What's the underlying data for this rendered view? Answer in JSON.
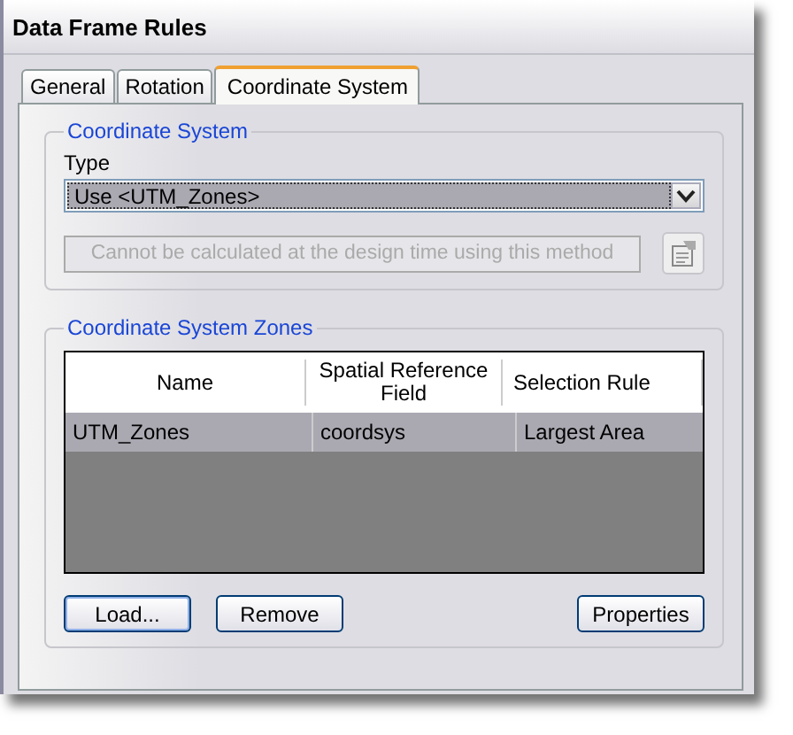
{
  "window": {
    "title": "Data Frame Rules"
  },
  "tabs": [
    {
      "label": "General",
      "selected": false
    },
    {
      "label": "Rotation",
      "selected": false
    },
    {
      "label": "Coordinate System",
      "selected": true
    }
  ],
  "coordinate_system": {
    "title": "Coordinate System",
    "type_label": "Type",
    "type_value": "Use <UTM_Zones>",
    "method_text": "Cannot be calculated at the design time using this method",
    "method_disabled": true
  },
  "zones": {
    "title": "Coordinate System Zones",
    "columns": [
      "Name",
      "Spatial Reference Field",
      "Selection Rule"
    ],
    "rows": [
      {
        "cells": [
          "UTM_Zones",
          "coordsys",
          "Largest Area"
        ],
        "selected": true
      }
    ]
  },
  "buttons": [
    "Load...",
    "Remove",
    "Properties"
  ]
}
